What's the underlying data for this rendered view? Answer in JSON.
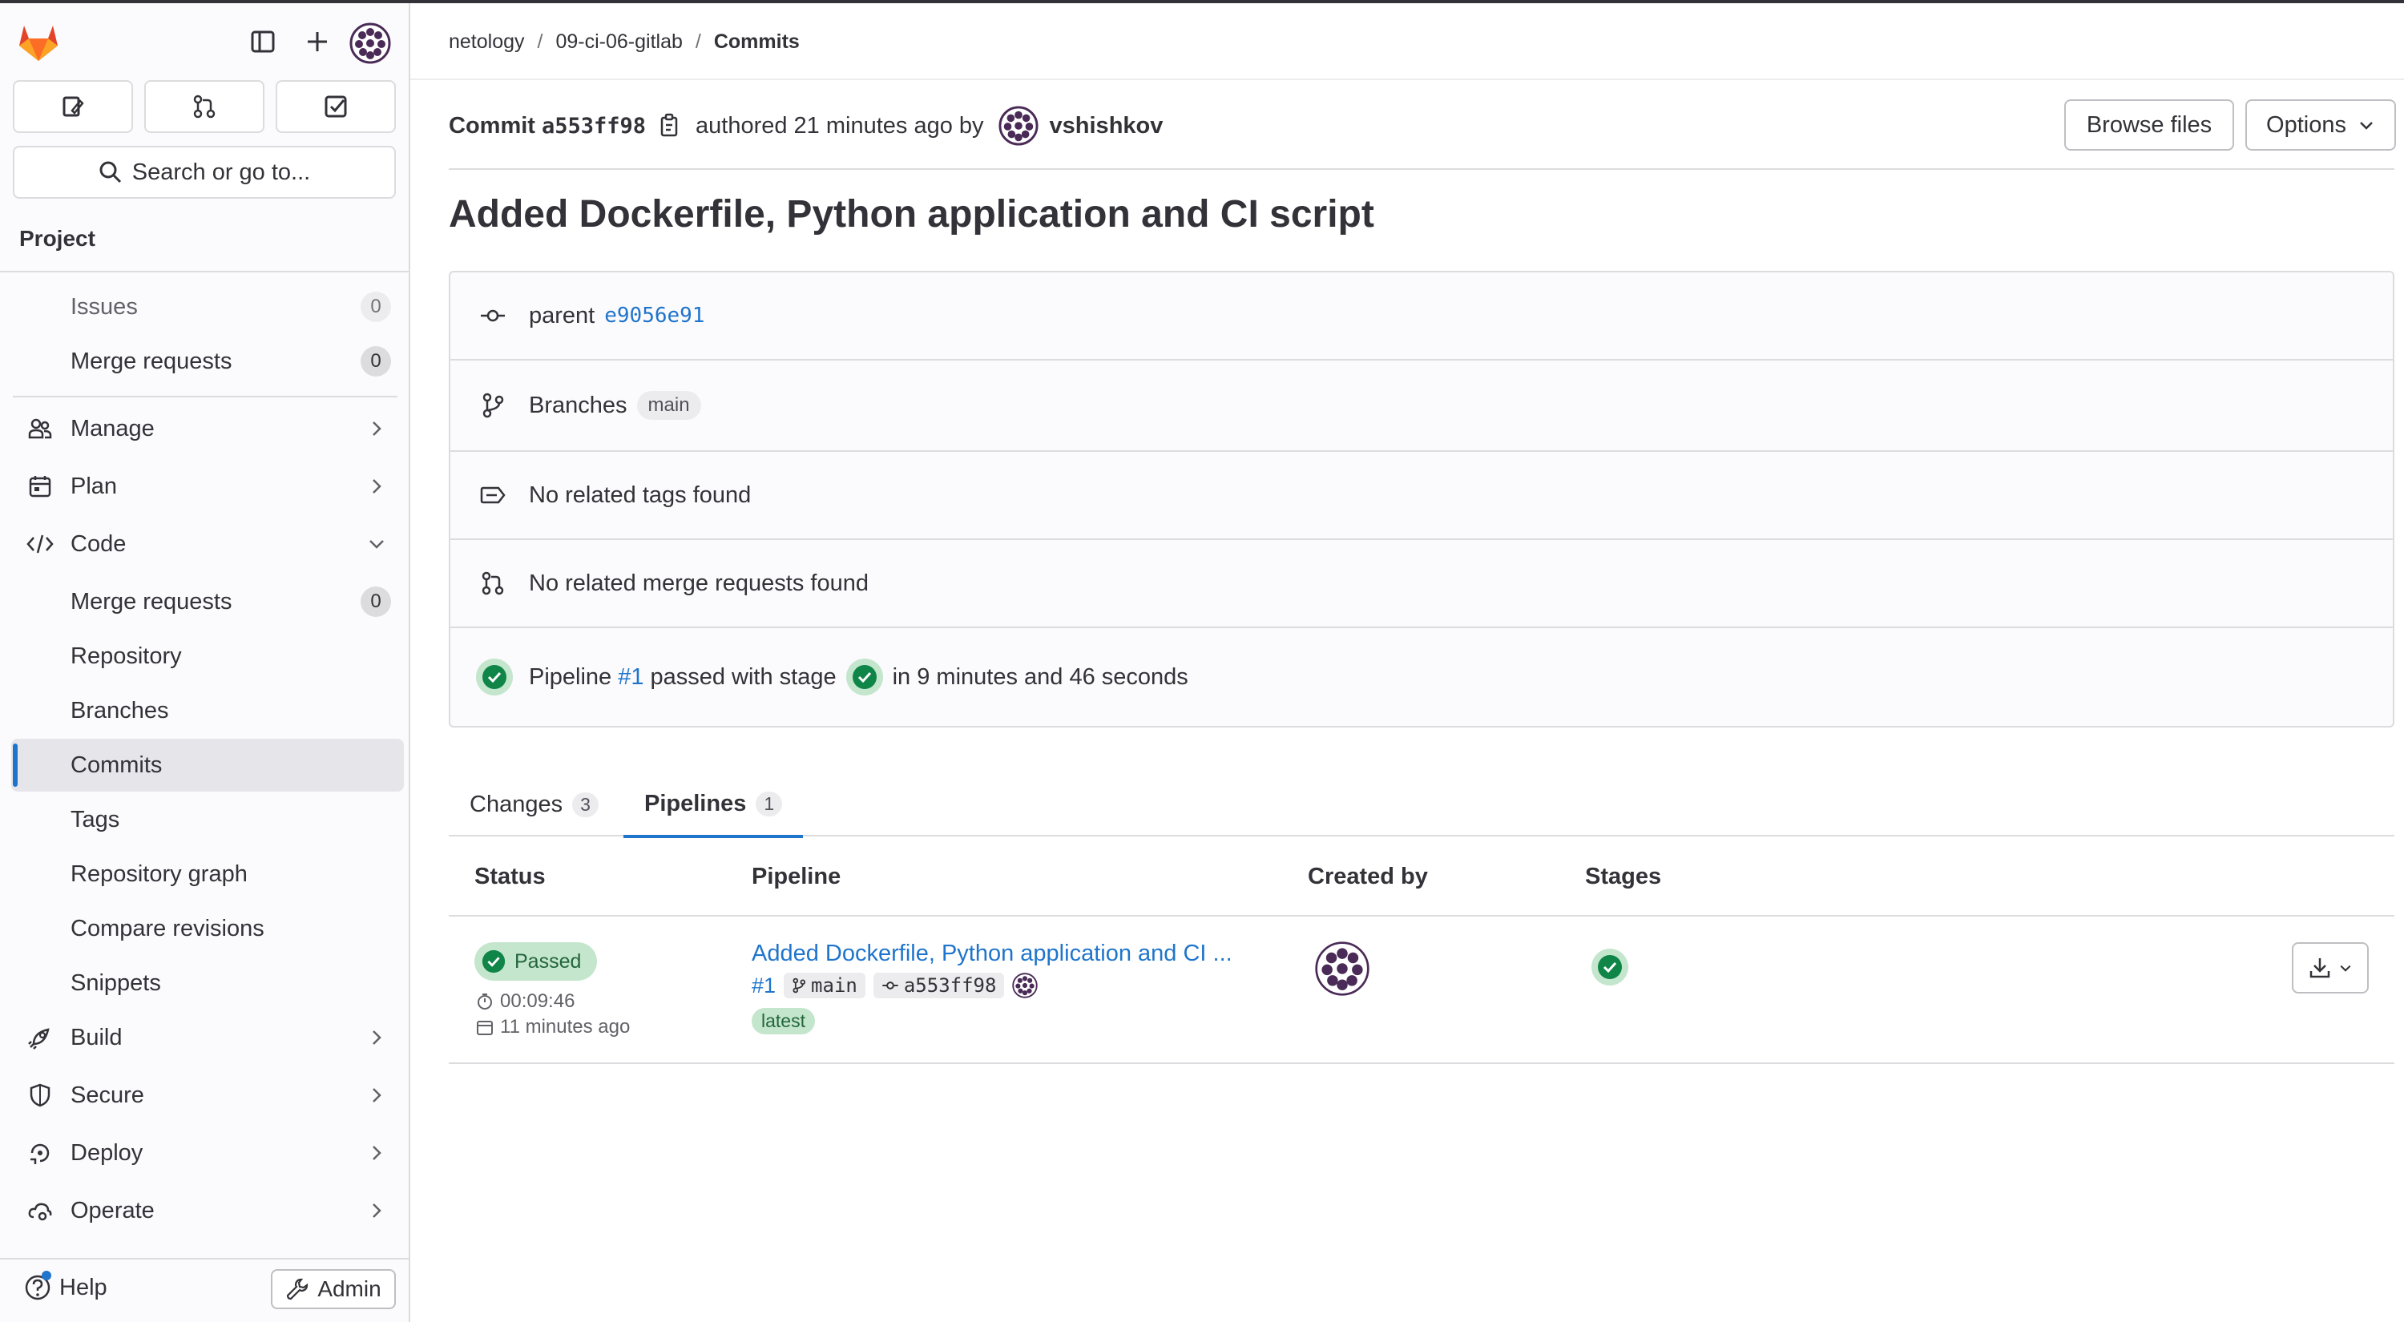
{
  "colors": {
    "accent": "#1f75cb",
    "success": "#108548",
    "success_bg": "#c3e6cd",
    "sidebar_bg": "#fbfafd"
  },
  "sidebar": {
    "search_placeholder": "Search or go to...",
    "section_title": "Project",
    "items": [
      {
        "label": "Issues",
        "count": "0",
        "icon": "none"
      },
      {
        "label": "Merge requests",
        "count": "0",
        "icon": "none"
      },
      {
        "label": "Manage",
        "icon": "users-icon"
      },
      {
        "label": "Plan",
        "icon": "calendar-icon"
      },
      {
        "label": "Code",
        "icon": "code-icon"
      },
      {
        "label": "Merge requests",
        "count": "0"
      },
      {
        "label": "Repository"
      },
      {
        "label": "Branches"
      },
      {
        "label": "Commits"
      },
      {
        "label": "Tags"
      },
      {
        "label": "Repository graph"
      },
      {
        "label": "Compare revisions"
      },
      {
        "label": "Snippets"
      },
      {
        "label": "Build",
        "icon": "rocket-icon"
      },
      {
        "label": "Secure",
        "icon": "shield-icon"
      },
      {
        "label": "Deploy",
        "icon": "deploy-icon"
      },
      {
        "label": "Operate",
        "icon": "cloud-gear-icon"
      }
    ],
    "help_label": "Help",
    "admin_label": "Admin"
  },
  "breadcrumb": {
    "group": "netology",
    "project": "09-ci-06-gitlab",
    "current": "Commits"
  },
  "commit": {
    "label": "Commit",
    "sha": "a553ff98",
    "authored_text": "authored 21 minutes ago by",
    "author": "vshishkov",
    "browse_files": "Browse files",
    "options": "Options",
    "title": "Added Dockerfile, Python application and CI script",
    "parent_label": "parent",
    "parent_sha": "e9056e91",
    "branches_label": "Branches",
    "branch": "main",
    "no_tags": "No related tags found",
    "no_mrs": "No related merge requests found",
    "pipeline_prefix": "Pipeline",
    "pipeline_id": "#1",
    "pipeline_passed": "passed with stage",
    "pipeline_duration": "in 9 minutes and 46 seconds"
  },
  "tabs": [
    {
      "label": "Changes",
      "count": "3"
    },
    {
      "label": "Pipelines",
      "count": "1"
    }
  ],
  "table": {
    "headers": [
      "Status",
      "Pipeline",
      "Created by",
      "Stages"
    ],
    "row": {
      "status": "Passed",
      "duration": "00:09:46",
      "finished": "11 minutes ago",
      "pipeline_title": "Added Dockerfile, Python application and CI ...",
      "pipeline_id": "#1",
      "branch": "main",
      "sha": "a553ff98",
      "tag": "latest"
    }
  }
}
